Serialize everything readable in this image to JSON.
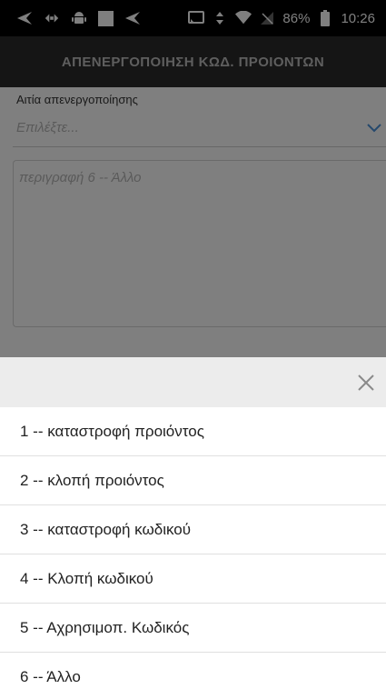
{
  "status_bar": {
    "battery_percent": "86%",
    "time": "10:26"
  },
  "app_bar": {
    "title": "ΑΠΕΝΕΡΓΟΠΟΙΗΣΗ ΚΩΔ. ΠΡΟΙΟΝΤΩΝ"
  },
  "form": {
    "reason_label": "Αιτία απενεργοποίησης",
    "reason_placeholder": "Επιλέξτε...",
    "description_placeholder": "περιγραφή 6 -- Άλλο"
  },
  "sheet": {
    "options": [
      {
        "label": "1 -- καταστροφή προιόντος"
      },
      {
        "label": "2 -- κλοπή προιόντος"
      },
      {
        "label": "3 -- καταστροφή κωδικού"
      },
      {
        "label": "4 -- Κλοπή κωδικού"
      },
      {
        "label": "5 -- Αχρησιμοπ. Κωδικός"
      },
      {
        "label": "6 -- Άλλο"
      }
    ]
  },
  "colors": {
    "accent": "#4a90d9",
    "overlay": "rgba(0,0,0,0.5)"
  }
}
